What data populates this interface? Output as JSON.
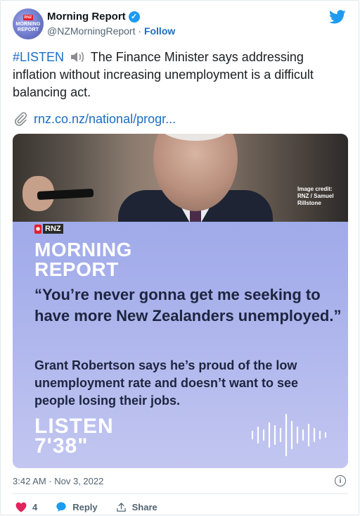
{
  "account": {
    "name": "Morning Report",
    "handle": "@NZMorningReport",
    "separator": " · ",
    "follow_label": "Follow",
    "avatar_text": [
      "RNZ",
      "MORNING",
      "REPORT"
    ]
  },
  "tweet": {
    "hashtag": "#LISTEN",
    "text": "The Finance Minister says addressing inflation without increasing unemployment is a difficult balancing act.",
    "link": "rnz.co.nz/national/progr...",
    "timestamp": "3:42 AM · Nov 3, 2022"
  },
  "media": {
    "image_credit": "Image credit: RNZ / Samuel Rillstone",
    "brand": "RNZ",
    "show_title_line1": "MORNING",
    "show_title_line2": "REPORT",
    "quote": "“You’re never gonna get me seeking to have more New Zealanders unemployed.”",
    "summary": "Grant Robertson says he’s proud of the low unemployment rate and doesn’t want to see people losing their jobs.",
    "listen_label": "LISTEN",
    "duration": "7'38\""
  },
  "actions": {
    "like_count": "4",
    "reply_label": "Reply",
    "share_label": "Share"
  },
  "colors": {
    "link": "#1b6ec2",
    "twitter_blue": "#1d9bf0",
    "like": "#e0245e",
    "rnz_red": "#e41e2b"
  },
  "icons": [
    "verified-badge-icon",
    "twitter-bird-icon",
    "speaker-icon",
    "paperclip-icon",
    "info-icon",
    "heart-icon",
    "reply-bubble-icon",
    "share-icon",
    "waveform-icon"
  ]
}
